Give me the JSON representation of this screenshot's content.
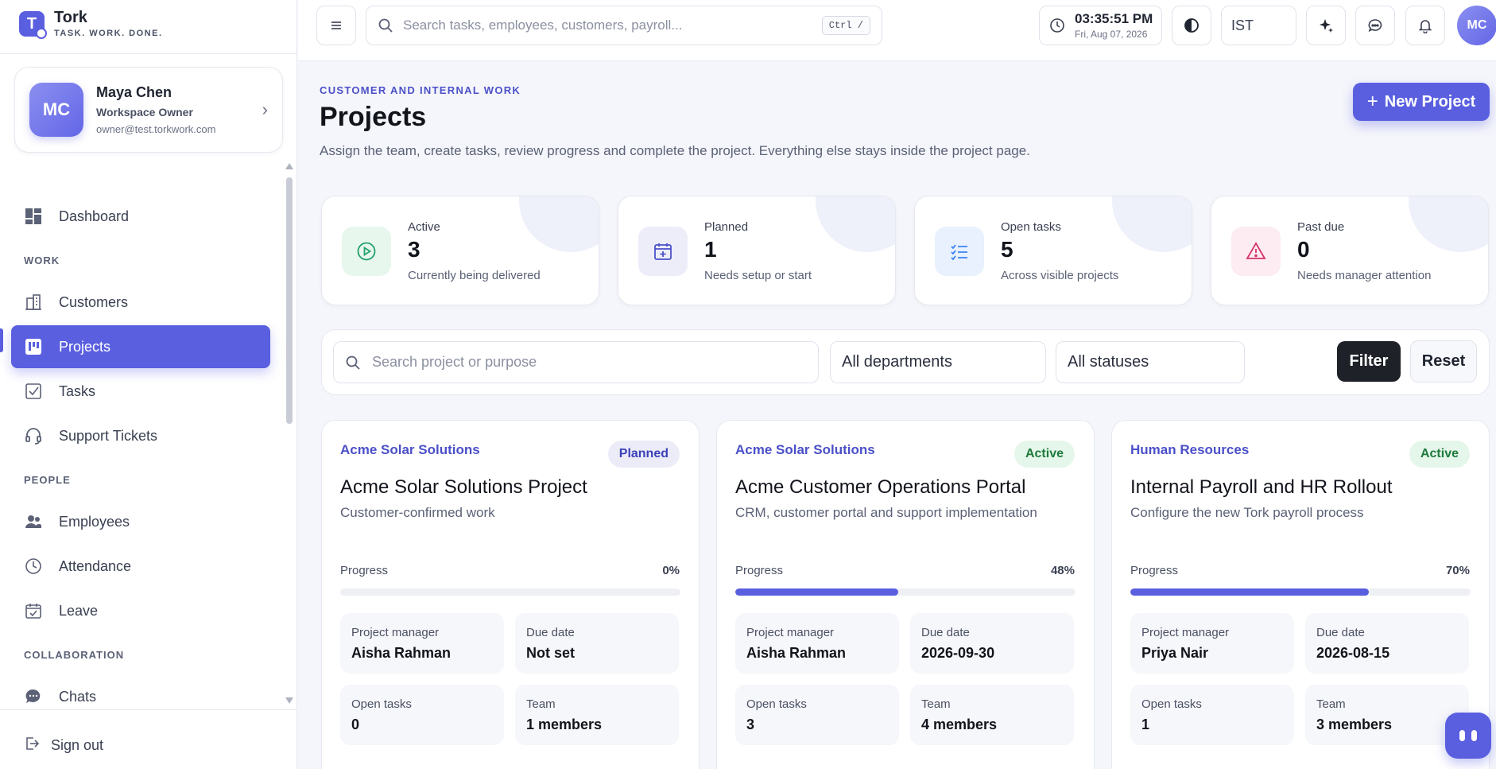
{
  "brand": {
    "name": "Tork",
    "tagline": "TASK. WORK. DONE.",
    "logo_letter": "T"
  },
  "user": {
    "initials": "MC",
    "name": "Maya Chen",
    "role": "Workspace Owner",
    "email": "owner@test.torkwork.com"
  },
  "nav": {
    "dashboard": "Dashboard",
    "section_work": "WORK",
    "customers": "Customers",
    "projects": "Projects",
    "tasks": "Tasks",
    "support": "Support Tickets",
    "section_people": "PEOPLE",
    "employees": "Employees",
    "attendance": "Attendance",
    "leave": "Leave",
    "section_collab": "COLLABORATION",
    "chats": "Chats",
    "signout": "Sign out"
  },
  "topbar": {
    "search_placeholder": "Search tasks, employees, customers, payroll...",
    "shortcut": "Ctrl /",
    "time": "03:35:51 PM",
    "date": "Fri, Aug 07, 2026",
    "timezone": "IST",
    "avatar_initials": "MC"
  },
  "page": {
    "eyebrow": "CUSTOMER AND INTERNAL WORK",
    "title": "Projects",
    "subtitle": "Assign the team, create tasks, review progress and complete the project. Everything else stays inside the project page.",
    "new_button": "New Project"
  },
  "stats": [
    {
      "label": "Active",
      "value": "3",
      "note": "Currently being delivered",
      "icon": "play-circle-icon",
      "color": "#22a06b",
      "bg": "#e7f7ee"
    },
    {
      "label": "Planned",
      "value": "1",
      "note": "Needs setup or start",
      "icon": "calendar-plus-icon",
      "color": "#4b50c8",
      "bg": "#ecedf9"
    },
    {
      "label": "Open tasks",
      "value": "5",
      "note": "Across visible projects",
      "icon": "checklist-icon",
      "color": "#3b82f6",
      "bg": "#e8f1fd"
    },
    {
      "label": "Past due",
      "value": "0",
      "note": "Needs manager attention",
      "icon": "warning-icon",
      "color": "#d6336c",
      "bg": "#fdecf2"
    }
  ],
  "filters": {
    "search_placeholder": "Search project or purpose",
    "department": "All departments",
    "status": "All statuses",
    "filter_button": "Filter",
    "reset_button": "Reset"
  },
  "projects": [
    {
      "customer": "Acme Solar Solutions",
      "status": "Planned",
      "status_kind": "planned",
      "title": "Acme Solar Solutions Project",
      "description": "Customer-confirmed work",
      "progress_label": "Progress",
      "progress_text": "0%",
      "progress": 0,
      "pm_label": "Project manager",
      "pm": "Aisha Rahman",
      "due_label": "Due date",
      "due": "Not set",
      "tasks_label": "Open tasks",
      "tasks": "0",
      "team_label": "Team",
      "team": "1 members"
    },
    {
      "customer": "Acme Solar Solutions",
      "status": "Active",
      "status_kind": "active",
      "title": "Acme Customer Operations Portal",
      "description": "CRM, customer portal and support implementation",
      "progress_label": "Progress",
      "progress_text": "48%",
      "progress": 48,
      "pm_label": "Project manager",
      "pm": "Aisha Rahman",
      "due_label": "Due date",
      "due": "2026-09-30",
      "tasks_label": "Open tasks",
      "tasks": "3",
      "team_label": "Team",
      "team": "4 members"
    },
    {
      "customer": "Human Resources",
      "status": "Active",
      "status_kind": "active",
      "title": "Internal Payroll and HR Rollout",
      "description": "Configure the new Tork payroll process",
      "progress_label": "Progress",
      "progress_text": "70%",
      "progress": 70,
      "pm_label": "Project manager",
      "pm": "Priya Nair",
      "due_label": "Due date",
      "due": "2026-08-15",
      "tasks_label": "Open tasks",
      "tasks": "1",
      "team_label": "Team",
      "team": "3 members"
    }
  ]
}
